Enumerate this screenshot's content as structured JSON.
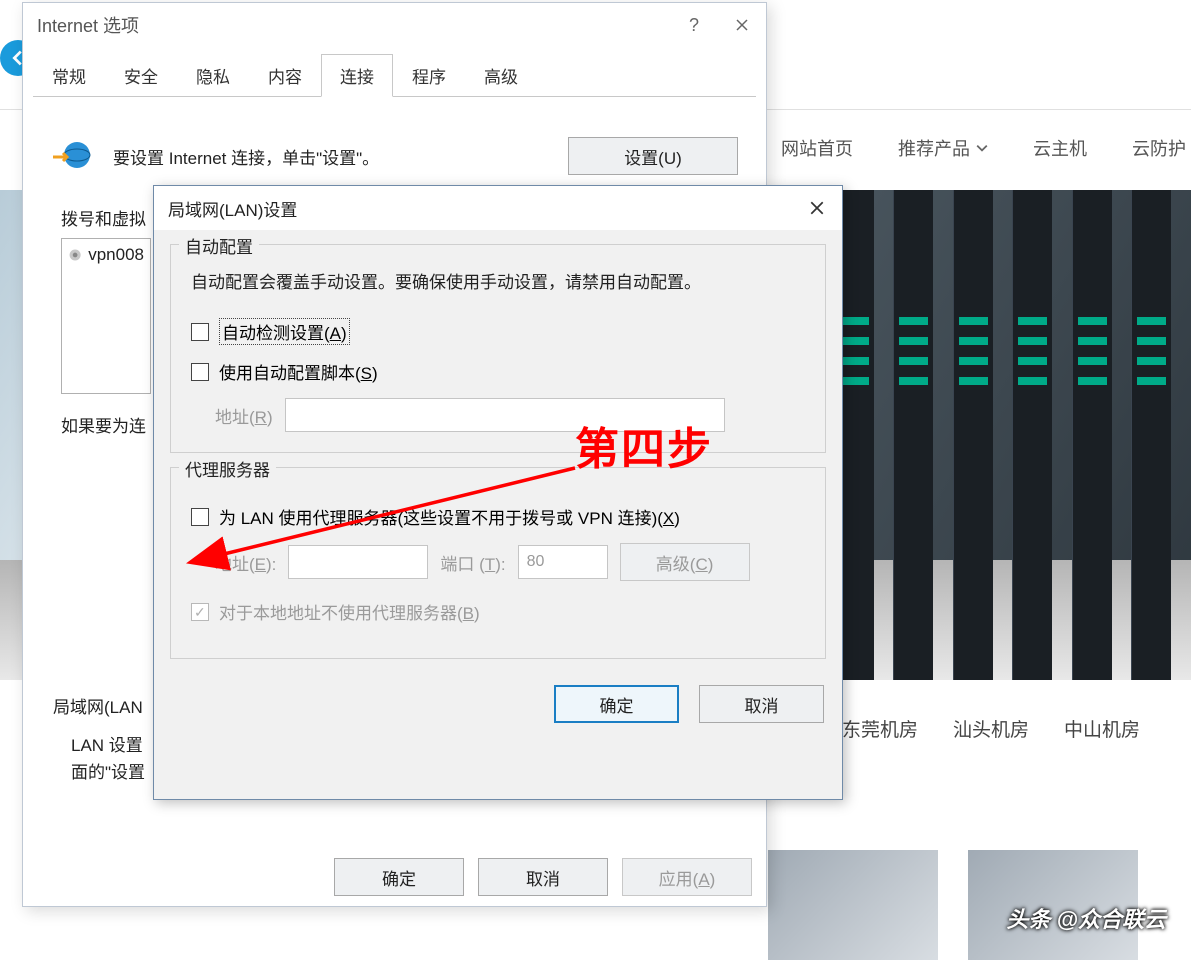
{
  "background": {
    "nav": [
      "网站首页",
      "推荐产品",
      "云主机",
      "云防护"
    ],
    "subnav_partial_1": "房",
    "subnav": [
      "东莞机房",
      "汕头机房",
      "中山机房"
    ],
    "watermark": "头条 @众合联云"
  },
  "parent": {
    "title": "Internet 选项",
    "tabs": [
      "常规",
      "安全",
      "隐私",
      "内容",
      "连接",
      "程序",
      "高级"
    ],
    "active_tab_index": 4,
    "setup_text": "要设置 Internet 连接，单击\"设置\"。",
    "setup_button": "设置(U)",
    "dialup_label": "拨号和虚拟",
    "vpn_item": "vpn008",
    "need_text": "如果要为连",
    "lan_label": "局域网(LAN",
    "lan_desc_1": "LAN 设置",
    "lan_desc_2": "面的\"设置",
    "footer": {
      "ok": "确定",
      "cancel": "取消",
      "apply": "应用(A)"
    }
  },
  "child": {
    "title": "局域网(LAN)设置",
    "group1": {
      "legend": "自动配置",
      "hint": "自动配置会覆盖手动设置。要确保使用手动设置，请禁用自动配置。",
      "auto_detect": "自动检测设置(A)",
      "auto_script": "使用自动配置脚本(S)",
      "addr_label_prefix": "地址(",
      "addr_label_key": "R",
      "addr_label_suffix": ")"
    },
    "group2": {
      "legend": "代理服务器",
      "use_proxy_prefix": "为 LAN 使用代理服务器(这些设置不用于拨号或 VPN 连接)(",
      "use_proxy_key": "X",
      "use_proxy_suffix": ")",
      "addr_label_prefix": "地址(",
      "addr_label_key": "E",
      "addr_label_suffix": "):",
      "port_label_prefix": "端口 (",
      "port_label_key": "T",
      "port_label_suffix": "):",
      "port_value": "80",
      "advanced": "高级(C)",
      "bypass_prefix": "对于本地地址不使用代理服务器(",
      "bypass_key": "B",
      "bypass_suffix": ")"
    },
    "footer": {
      "ok": "确定",
      "cancel": "取消"
    }
  },
  "annotation": {
    "text": "第四步"
  }
}
